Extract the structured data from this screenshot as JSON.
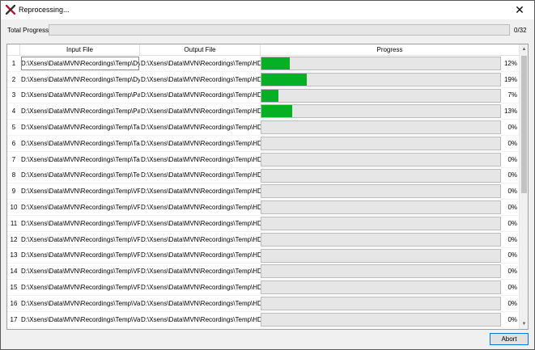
{
  "window": {
    "title": "Reprocessing...",
    "close_glyph": "✕"
  },
  "total_progress": {
    "label": "Total Progress",
    "count_text": "0/32",
    "fraction": 0
  },
  "table": {
    "columns": [
      "Input File",
      "Output File",
      "Progress"
    ],
    "rows": [
      {
        "num": "1",
        "input": "D:\\Xsens\\Data\\MVN\\Recordings\\Temp\\Dy",
        "output": "D:\\Xsens\\Data\\MVN\\Recordings\\Temp\\HD",
        "progress": 0.12,
        "pct": "12%"
      },
      {
        "num": "2",
        "input": "D:\\Xsens\\Data\\MVN\\Recordings\\Temp\\Dy",
        "output": "D:\\Xsens\\Data\\MVN\\Recordings\\Temp\\HD",
        "progress": 0.19,
        "pct": "19%"
      },
      {
        "num": "3",
        "input": "D:\\Xsens\\Data\\MVN\\Recordings\\Temp\\Pa",
        "output": "D:\\Xsens\\Data\\MVN\\Recordings\\Temp\\HD",
        "progress": 0.07,
        "pct": "7%"
      },
      {
        "num": "4",
        "input": "D:\\Xsens\\Data\\MVN\\Recordings\\Temp\\Pa",
        "output": "D:\\Xsens\\Data\\MVN\\Recordings\\Temp\\HD",
        "progress": 0.13,
        "pct": "13%"
      },
      {
        "num": "5",
        "input": "D:\\Xsens\\Data\\MVN\\Recordings\\Temp\\Ta",
        "output": "D:\\Xsens\\Data\\MVN\\Recordings\\Temp\\HD",
        "progress": 0,
        "pct": "0%"
      },
      {
        "num": "6",
        "input": "D:\\Xsens\\Data\\MVN\\Recordings\\Temp\\Ta",
        "output": "D:\\Xsens\\Data\\MVN\\Recordings\\Temp\\HD",
        "progress": 0,
        "pct": "0%"
      },
      {
        "num": "7",
        "input": "D:\\Xsens\\Data\\MVN\\Recordings\\Temp\\Ta",
        "output": "D:\\Xsens\\Data\\MVN\\Recordings\\Temp\\HD",
        "progress": 0,
        "pct": "0%"
      },
      {
        "num": "8",
        "input": "D:\\Xsens\\Data\\MVN\\Recordings\\Temp\\Te",
        "output": "D:\\Xsens\\Data\\MVN\\Recordings\\Temp\\HD",
        "progress": 0,
        "pct": "0%"
      },
      {
        "num": "9",
        "input": "D:\\Xsens\\Data\\MVN\\Recordings\\Temp\\VR",
        "output": "D:\\Xsens\\Data\\MVN\\Recordings\\Temp\\HD",
        "progress": 0,
        "pct": "0%"
      },
      {
        "num": "10",
        "input": "D:\\Xsens\\Data\\MVN\\Recordings\\Temp\\VR",
        "output": "D:\\Xsens\\Data\\MVN\\Recordings\\Temp\\HD",
        "progress": 0,
        "pct": "0%"
      },
      {
        "num": "11",
        "input": "D:\\Xsens\\Data\\MVN\\Recordings\\Temp\\VR",
        "output": "D:\\Xsens\\Data\\MVN\\Recordings\\Temp\\HD",
        "progress": 0,
        "pct": "0%"
      },
      {
        "num": "12",
        "input": "D:\\Xsens\\Data\\MVN\\Recordings\\Temp\\VR",
        "output": "D:\\Xsens\\Data\\MVN\\Recordings\\Temp\\HD",
        "progress": 0,
        "pct": "0%"
      },
      {
        "num": "13",
        "input": "D:\\Xsens\\Data\\MVN\\Recordings\\Temp\\VR",
        "output": "D:\\Xsens\\Data\\MVN\\Recordings\\Temp\\HD",
        "progress": 0,
        "pct": "0%"
      },
      {
        "num": "14",
        "input": "D:\\Xsens\\Data\\MVN\\Recordings\\Temp\\VR",
        "output": "D:\\Xsens\\Data\\MVN\\Recordings\\Temp\\HD",
        "progress": 0,
        "pct": "0%"
      },
      {
        "num": "15",
        "input": "D:\\Xsens\\Data\\MVN\\Recordings\\Temp\\VR",
        "output": "D:\\Xsens\\Data\\MVN\\Recordings\\Temp\\HD",
        "progress": 0,
        "pct": "0%"
      },
      {
        "num": "16",
        "input": "D:\\Xsens\\Data\\MVN\\Recordings\\Temp\\Va",
        "output": "D:\\Xsens\\Data\\MVN\\Recordings\\Temp\\HD",
        "progress": 0,
        "pct": "0%"
      },
      {
        "num": "17",
        "input": "D:\\Xsens\\Data\\MVN\\Recordings\\Temp\\Va",
        "output": "D:\\Xsens\\Data\\MVN\\Recordings\\Temp\\HD",
        "progress": 0,
        "pct": "0%"
      }
    ]
  },
  "footer": {
    "abort_label": "Abort"
  },
  "colors": {
    "progress_fill": "#06b025",
    "progress_track": "#e6e6e6",
    "focus_border": "#0078d7",
    "app_icon_red": "#c8102e"
  },
  "icons": {
    "app": "xsens-logo-icon",
    "close": "close-icon",
    "scroll_up": "scroll-up-arrow-icon",
    "scroll_down": "scroll-down-arrow-icon"
  }
}
